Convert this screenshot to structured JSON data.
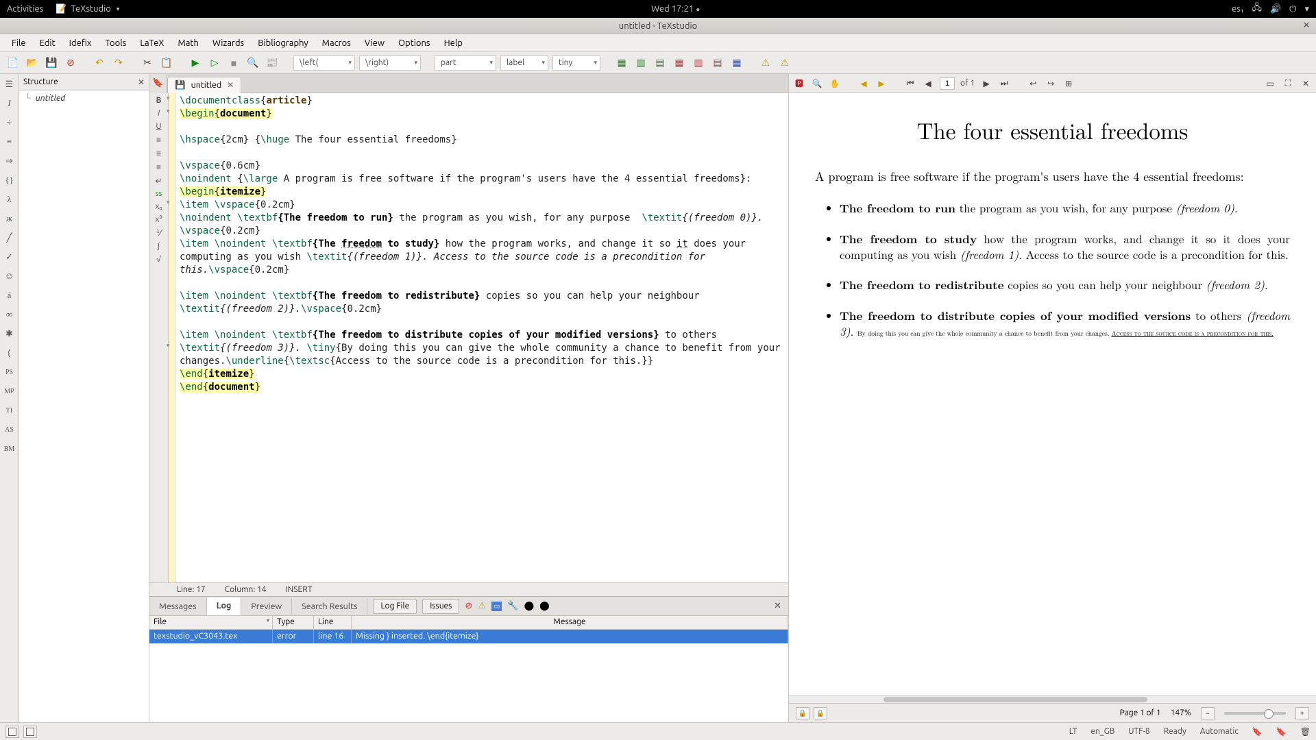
{
  "os": {
    "activities": "Activities",
    "app": "TeXstudio",
    "clock": "Wed 17:21",
    "lang": "es₁"
  },
  "window": {
    "title": "untitled - TeXstudio"
  },
  "menu": {
    "items": [
      "File",
      "Edit",
      "Idefix",
      "Tools",
      "LaTeX",
      "Math",
      "Wizards",
      "Bibliography",
      "Macros",
      "View",
      "Options",
      "Help"
    ]
  },
  "toolbar": {
    "combo_left": "\\left(",
    "combo_right": "\\right)",
    "combo_part": "part",
    "combo_label": "label",
    "combo_tiny": "tiny"
  },
  "structure": {
    "title": "Structure",
    "doc": "untitled"
  },
  "tab": {
    "name": "untitled"
  },
  "status": {
    "line": "Line: 17",
    "col": "Column: 14",
    "mode": "INSERT"
  },
  "code": {
    "l1a": "\\documentclass",
    "l1b": "{",
    "l1c": "article",
    "l1d": "}",
    "l2a": "\\begin",
    "l2b": "{",
    "l2c": "document",
    "l2d": "}",
    "l4a": "\\hspace",
    "l4b": "{2cm} {",
    "l4c": "\\huge",
    "l4d": " The four essential freedoms}",
    "l6a": "\\vspace",
    "l6b": "{0.6cm}",
    "l7a": "\\noindent",
    "l7b": " {",
    "l7c": "\\large",
    "l7d": " A program is free software if the program's users have the 4 essential freedoms}:",
    "l8a": "\\begin",
    "l8b": "{",
    "l8c": "itemize",
    "l8d": "}",
    "l9a": "\\item",
    "l9b": " ",
    "l9c": "\\vspace",
    "l9d": "{0.2cm}",
    "l10a": "\\noindent",
    "l10b": " ",
    "l10c": "\\textbf",
    "l10d": "{The freedom to run}",
    "l10e": " the program as you wish, for any purpose  ",
    "l10f": "\\textit",
    "l10g": "{(freedom 0)}. ",
    "l10h": "\\vspace",
    "l10i": "{0.2cm}",
    "l11a": "\\item",
    "l11b": " ",
    "l11c": "\\noindent",
    "l11d": " ",
    "l11e": "\\textbf",
    "l11f": "{The ",
    "l11g": "freedom",
    "l11h": " to study}",
    "l11i": " how the program works, and change it so ",
    "l11j": "it",
    "l11k": " does your computing as you wish ",
    "l11l": "\\textit",
    "l11m": "{(freedom 1)}. Access to the source code is a precondition for this.",
    "l11n": "\\vspace",
    "l11o": "{0.2cm}",
    "l13a": "\\item",
    "l13b": " ",
    "l13c": "\\noindent",
    "l13d": " ",
    "l13e": "\\textbf",
    "l13f": "{The freedom to redistribute}",
    "l13g": " copies so you can help your neighbour  ",
    "l13h": "\\textit",
    "l13i": "{(freedom 2)}.",
    "l13j": "\\vspace",
    "l13k": "{0.2cm}",
    "l15a": "\\item",
    "l15b": " ",
    "l15c": "\\noindent",
    "l15d": " ",
    "l15e": "\\textbf",
    "l15f": "{The freedom to distribute copies of your modified versions}",
    "l15g": " to others  ",
    "l15h": "\\textit",
    "l15i": "{(freedom 3)}. ",
    "l15j": "\\tiny",
    "l15k": "{By doing this you can give the whole community a chance to benefit from your changes.",
    "l15l": "\\underline",
    "l15m": "{",
    "l15n": "\\textsc",
    "l15o": "{Access to the source code is a precondition for this.}}",
    "l16a": "\\end",
    "l16b": "{",
    "l16c": "itemize",
    "l16d": "}",
    "l17a": "\\end",
    "l17b": "{",
    "l17c": "document",
    "l17d": "}"
  },
  "log": {
    "tabs": [
      "Messages",
      "Log",
      "Preview",
      "Search Results"
    ],
    "btn_logfile": "Log File",
    "btn_issues": "Issues",
    "headers": {
      "file": "File",
      "type": "Type",
      "line": "Line",
      "msg": "Message"
    },
    "row": {
      "file": "texstudio_vC3043.tex",
      "type": "error",
      "line": "line 16",
      "msg": "Missing } inserted. \\end{itemize}"
    }
  },
  "preview": {
    "page_input": "1",
    "of": "of 1",
    "title": "The four essential freedoms",
    "intro": "A program is free software if the program's users have the 4 essential freedoms:",
    "i1b": "The freedom to run",
    "i1t": " the program as you wish, for any purpose ",
    "i1i": "(freedom 0)",
    "i1e": ".",
    "i2b": "The freedom to study",
    "i2t": " how the program works, and change it so it does your computing as you wish ",
    "i2i": "(freedom 1)",
    "i2e": ".  Access to the source code is a precondition for this.",
    "i3b": "The freedom to redistribute",
    "i3t": " copies so you can help your neighbour ",
    "i3i": "(freedom 2)",
    "i3e": ".",
    "i4b": "The freedom to distribute copies of your modified versions",
    "i4t": " to others ",
    "i4i": "(freedom 3)",
    "i4e": ". ",
    "i4tiny1": "By doing this you can give the whole community a chance to benefit from your changes. ",
    "i4sc": "Access to the source code is a precondition for this.",
    "footer_page": "Page 1 of 1",
    "footer_zoom": "147%"
  },
  "bottom": {
    "lt": "LT",
    "lang": "en_GB",
    "enc": "UTF-8",
    "ready": "Ready",
    "auto": "Automatic"
  }
}
